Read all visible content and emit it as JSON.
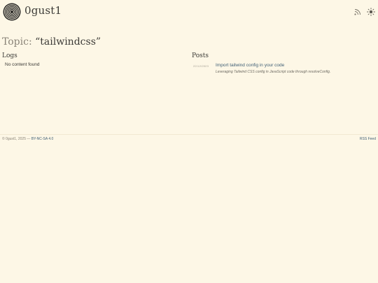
{
  "header": {
    "site_title": "0gust1",
    "icons": [
      "spiral-logo",
      "rss-icon",
      "sun-icon"
    ]
  },
  "topic": {
    "prefix": "Topic:",
    "name": "“tailwindcss”"
  },
  "logs": {
    "title": "Logs",
    "empty_text": "No content found"
  },
  "posts": {
    "title": "Posts",
    "items": [
      {
        "date": "22/12/2023",
        "title": "Import tailwind config in your code",
        "description": "Leveraging Tailwind CSS config in JavaScript code through resolveConfig."
      }
    ]
  },
  "footer": {
    "copyright": "© 0gust1, 2025 —",
    "license": "BY-NC-SA 4.0",
    "rss_link": "RSS Feed"
  },
  "colors": {
    "background": "#fdf7e6",
    "text": "#3b3a36",
    "link": "#3f5f75",
    "muted": "#8a8478"
  }
}
